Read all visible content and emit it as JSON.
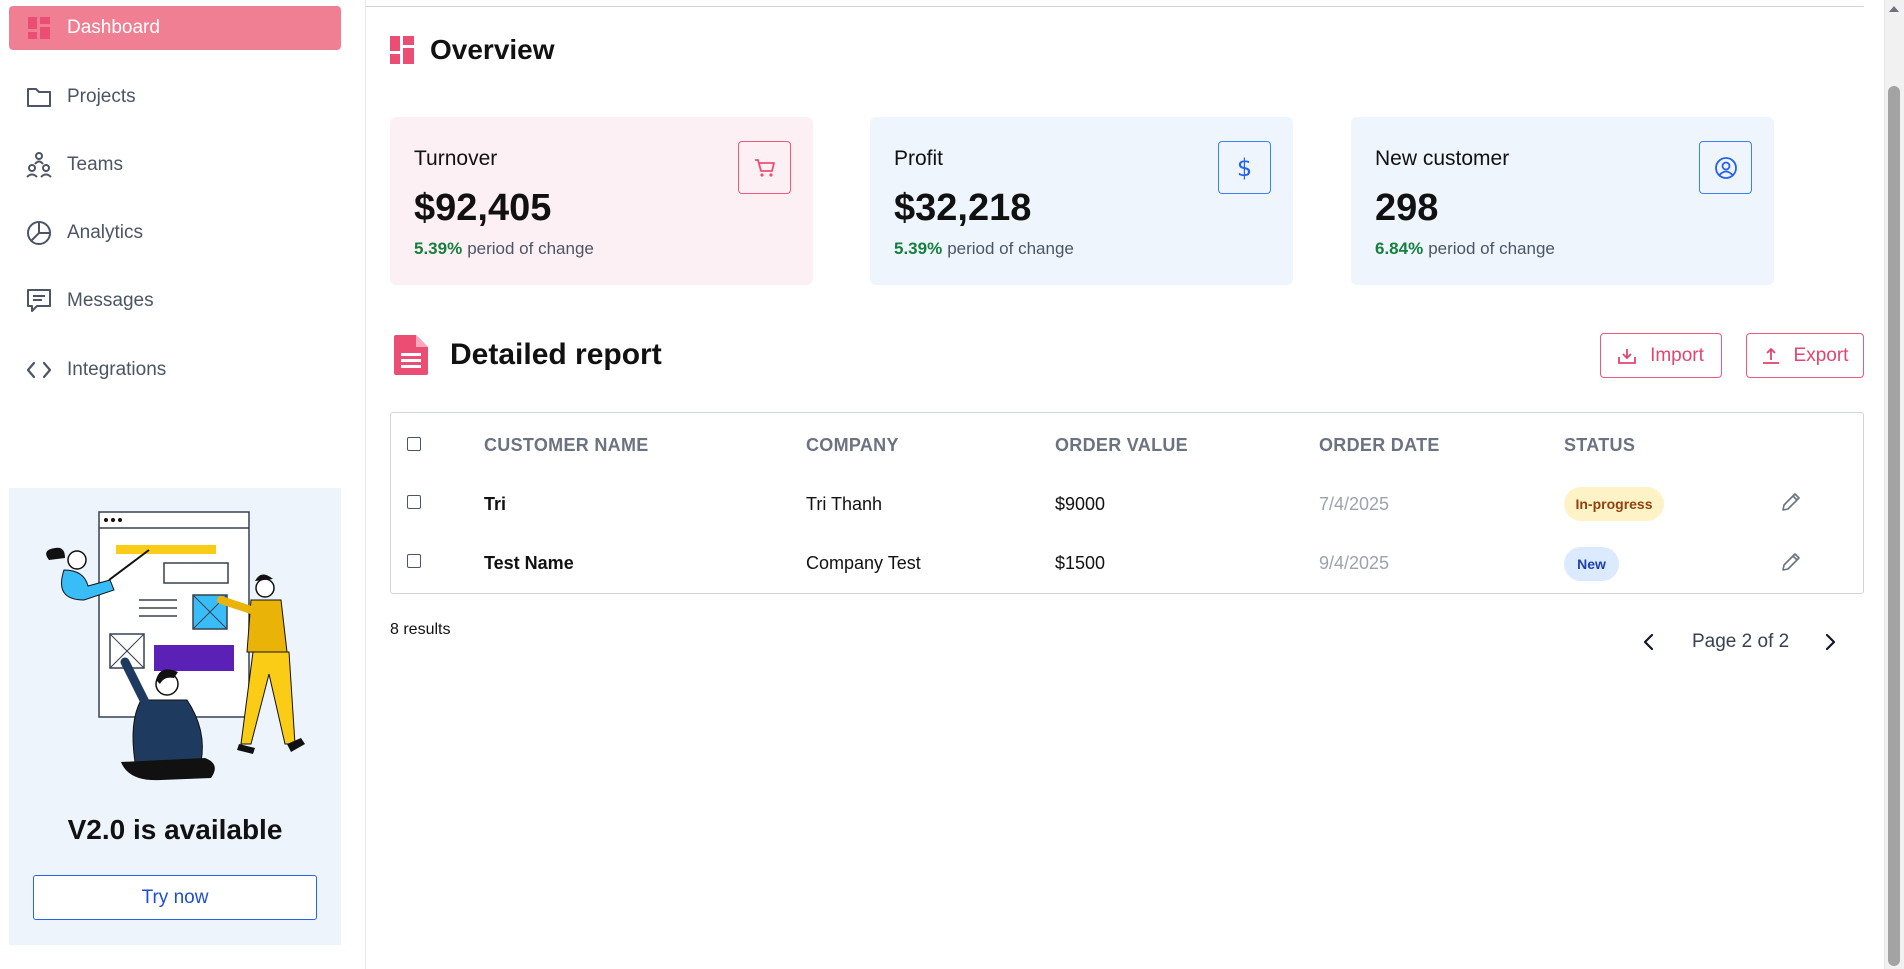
{
  "sidebar": {
    "items": [
      {
        "label": "Dashboard",
        "icon": "dashboard-icon",
        "active": true
      },
      {
        "label": "Projects",
        "icon": "folder-icon"
      },
      {
        "label": "Teams",
        "icon": "teams-icon"
      },
      {
        "label": "Analytics",
        "icon": "pie-chart-icon"
      },
      {
        "label": "Messages",
        "icon": "message-icon"
      },
      {
        "label": "Integrations",
        "icon": "code-icon"
      }
    ],
    "promo": {
      "title": "V2.0 is available",
      "button": "Try now"
    }
  },
  "overview": {
    "title": "Overview",
    "cards": [
      {
        "label": "Turnover",
        "value": "$92,405",
        "pct": "5.39%",
        "change_text": "period of change",
        "icon": "cart-icon"
      },
      {
        "label": "Profit",
        "value": "$32,218",
        "pct": "5.39%",
        "change_text": "period of change",
        "icon": "dollar-icon"
      },
      {
        "label": "New customer",
        "value": "298",
        "pct": "6.84%",
        "change_text": "period of change",
        "icon": "user-circle-icon"
      }
    ]
  },
  "report": {
    "title": "Detailed report",
    "import_label": "Import",
    "export_label": "Export",
    "columns": [
      "CUSTOMER NAME",
      "COMPANY",
      "ORDER VALUE",
      "ORDER DATE",
      "STATUS"
    ],
    "rows": [
      {
        "name": "Tri",
        "company": "Tri Thanh",
        "value": "$9000",
        "date": "7/4/2025",
        "status": "In-progress"
      },
      {
        "name": "Test Name",
        "company": "Company Test",
        "value": "$1500",
        "date": "9/4/2025",
        "status": "New"
      }
    ],
    "results": "8 results",
    "page_label": "Page 2 of 2"
  },
  "colors": {
    "accent": "#f07f93",
    "accent_strong": "#e0466f",
    "blue": "#3b82f6",
    "green": "#15803d",
    "badge_progress_bg": "#fef3c7",
    "badge_new_bg": "#dbeafe"
  }
}
